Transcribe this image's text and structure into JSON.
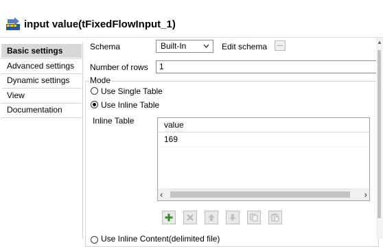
{
  "header": {
    "title": "input value(tFixedFlowInput_1)",
    "icon": "component-icon"
  },
  "sidebar": {
    "items": [
      {
        "label": "Basic settings",
        "active": true
      },
      {
        "label": "Advanced settings"
      },
      {
        "label": "Dynamic settings"
      },
      {
        "label": "View"
      },
      {
        "label": "Documentation"
      }
    ]
  },
  "main": {
    "schema_label": "Schema",
    "schema_value": "Built-In",
    "edit_schema_label": "Edit schema",
    "edit_schema_button": "...",
    "rows_label": "Number of rows",
    "rows_value": "1",
    "mode_label": "Mode",
    "radio_single": "Use Single Table",
    "radio_inline": "Use Inline Table",
    "inline_table_label": "Inline Table",
    "table": {
      "columns": [
        "value"
      ],
      "rows": [
        [
          "169"
        ]
      ]
    },
    "radio_content_partial": "Use Inline Content(delimited file)"
  },
  "colors": {
    "accent": "#3a8a2b",
    "selected_bg": "#d8d8d8"
  }
}
